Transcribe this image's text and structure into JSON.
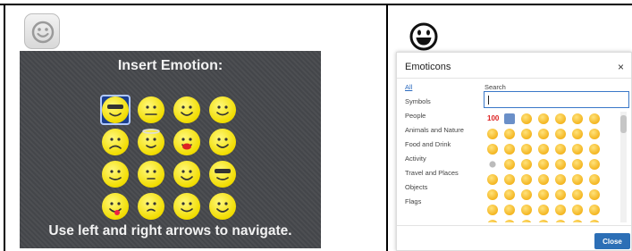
{
  "left_panel": {
    "title": "Insert Emotion:",
    "hint": "Use left and right arrows to navigate.",
    "smiley_button_icon": "smiley-face-icon",
    "emotions": [
      "sunglasses-face",
      "grimacing-face",
      "cool-face",
      "squinting-face",
      "frowning-face",
      "halo-face",
      "kissing-face",
      "smiling-face",
      "money-face",
      "dizzy-face",
      "happy-face",
      "hat-face",
      "tongue-face",
      "surprised-face",
      "winking-face",
      "devil-face"
    ],
    "selected_index": 0,
    "colors": {
      "panel": "#47494d",
      "emoji": "#f1dc00",
      "selection": "#1b3f8f"
    }
  },
  "dialog": {
    "header_icon": "grinning-face-icon",
    "title": "Emoticons",
    "close_symbol": "×",
    "search_label": "Search",
    "search_value": "",
    "categories": [
      "All",
      "Symbols",
      "People",
      "Animals and Nature",
      "Food and Drink",
      "Activity",
      "Travel and Places",
      "Objects",
      "Flags"
    ],
    "active_category": "All",
    "close_button_label": "Close",
    "colors": {
      "accent": "#2c6fb6",
      "link": "#2c6bbf"
    }
  }
}
